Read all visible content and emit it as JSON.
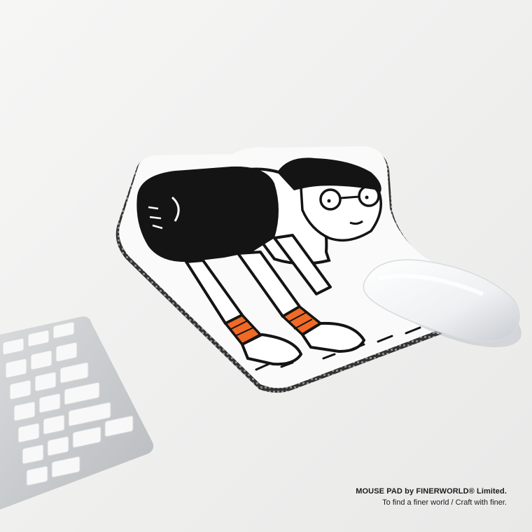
{
  "photo": {
    "subject": "illustrated mouse pad with wrist rest, white mouse and keyboard",
    "colors": {
      "background": "#f1f1f0",
      "pad_surface": "#fafafa",
      "ink": "#141414",
      "socks": "#f06a25",
      "keyboard_frame": "#c9cbcd",
      "keycap": "#f8f8f8",
      "mouse": "#f4f5f7"
    }
  },
  "caption": {
    "line1": "MOUSE PAD by FINERWORLD® Limited.",
    "line2": "To find a finer world / Craft with finer."
  }
}
